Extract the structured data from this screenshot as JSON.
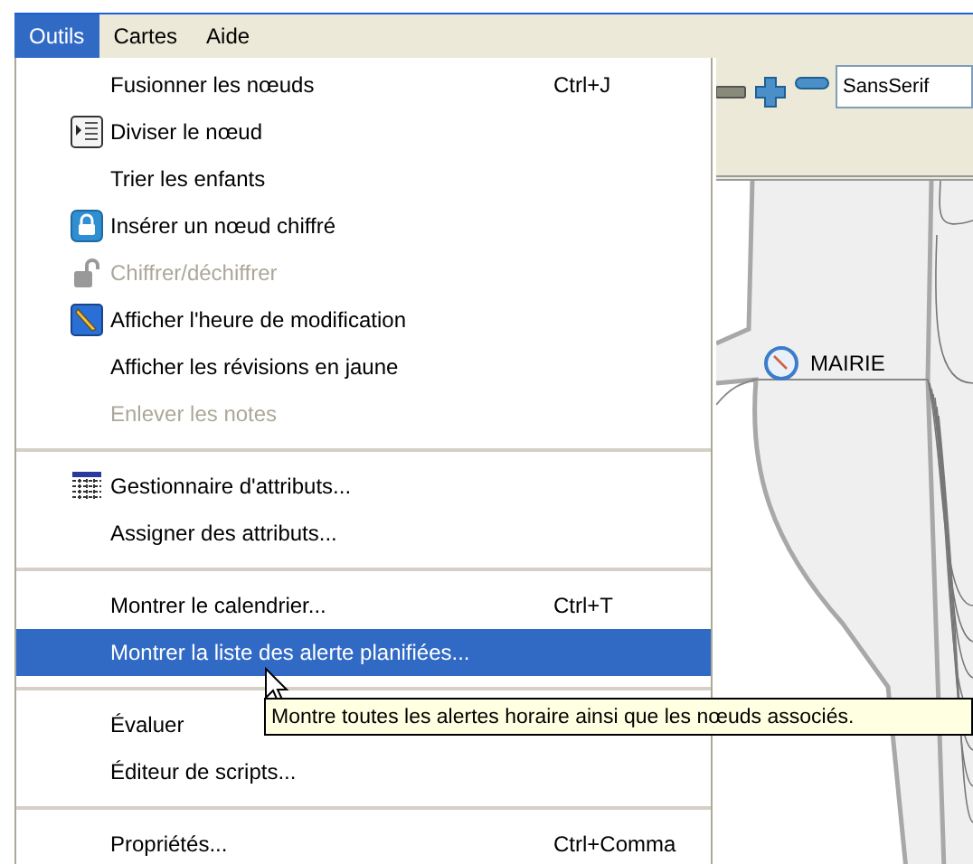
{
  "menubar": [
    {
      "label": "Outils",
      "selected": true
    },
    {
      "label": "Cartes",
      "selected": false
    },
    {
      "label": "Aide",
      "selected": false
    }
  ],
  "menu": [
    {
      "kind": "item",
      "label": "Fusionner les nœuds",
      "shortcut": "Ctrl+J",
      "disabled": false,
      "selected": false
    },
    {
      "kind": "item",
      "label": "Diviser le nœud",
      "disabled": false,
      "selected": false
    },
    {
      "kind": "item",
      "label": "Trier les enfants",
      "disabled": false,
      "selected": false
    },
    {
      "kind": "item",
      "label": "Insérer un nœud chiffré",
      "disabled": false,
      "selected": false
    },
    {
      "kind": "item",
      "label": "Chiffrer/déchiffrer",
      "disabled": true,
      "selected": false
    },
    {
      "kind": "item",
      "label": "Afficher l'heure de modification",
      "disabled": false,
      "selected": false
    },
    {
      "kind": "item",
      "label": "Afficher les révisions en jaune",
      "disabled": false,
      "selected": false
    },
    {
      "kind": "item",
      "label": "Enlever les notes",
      "disabled": true,
      "selected": false
    },
    {
      "kind": "separator"
    },
    {
      "kind": "item",
      "label": "Gestionnaire d'attributs...",
      "disabled": false,
      "selected": false
    },
    {
      "kind": "item",
      "label": "Assigner des attributs...",
      "disabled": false,
      "selected": false
    },
    {
      "kind": "separator"
    },
    {
      "kind": "item",
      "label": "Montrer le calendrier...",
      "shortcut": "Ctrl+T",
      "disabled": false,
      "selected": false
    },
    {
      "kind": "item",
      "label": "Montrer la liste des alerte planifiées...",
      "disabled": false,
      "selected": true
    },
    {
      "kind": "separator"
    },
    {
      "kind": "item",
      "label": "Évaluer",
      "disabled": false,
      "selected": false
    },
    {
      "kind": "item",
      "label": "Éditeur de scripts...",
      "disabled": false,
      "selected": false
    },
    {
      "kind": "separator"
    },
    {
      "kind": "item",
      "label": "Propriétés...",
      "shortcut": "Ctrl+Comma",
      "disabled": false,
      "selected": false
    }
  ],
  "toolbar": {
    "font_field": "SansSerif"
  },
  "map": {
    "node": "MAIRIE"
  },
  "tooltip": "Montre toutes les alertes horaire ainsi que les nœuds associés."
}
